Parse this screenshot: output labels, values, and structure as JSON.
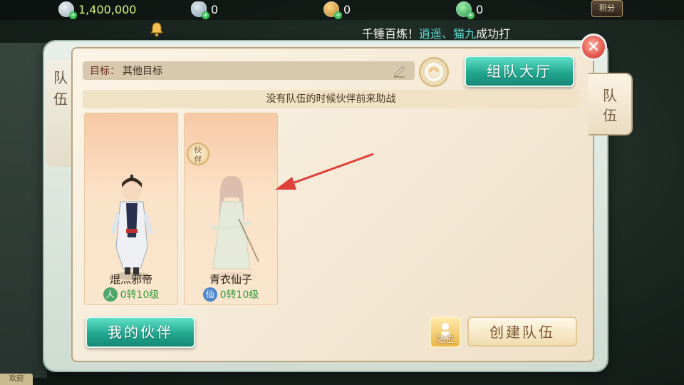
{
  "resources": [
    {
      "icon": "silver-coin-icon",
      "value": "1,400,000"
    },
    {
      "icon": "ingot-icon",
      "value": "0"
    },
    {
      "icon": "gold-coin-icon",
      "value": "0"
    },
    {
      "icon": "jade-icon",
      "value": "0"
    }
  ],
  "points_label": "积分",
  "announcement": {
    "prefix": "千锤百炼！",
    "name1": "逍遥",
    "separator": "、",
    "name2": "猫九",
    "suffix": "成功打"
  },
  "left_tab_label": "队伍",
  "right_tab_label": "队伍",
  "goal": {
    "label": "目标：",
    "value": "其他目标"
  },
  "hall_button": "组队大厅",
  "hint": "没有队伍的时候伙伴前来助战",
  "cards": [
    {
      "name": "焜灬邪帝",
      "sect": "人",
      "level": "0转10级"
    },
    {
      "name": "青衣仙子",
      "sect": "仙",
      "level": "0转10级",
      "badge": "伙伴"
    }
  ],
  "partner_button": "我的伙伴",
  "stand_label": "站位",
  "create_button": "创建队伍",
  "bottom_tag": "欢迎",
  "colors": {
    "accent_green": "#22a88f",
    "highlight_cyan": "#5fe0d6",
    "level_green": "#2e9c3e"
  }
}
